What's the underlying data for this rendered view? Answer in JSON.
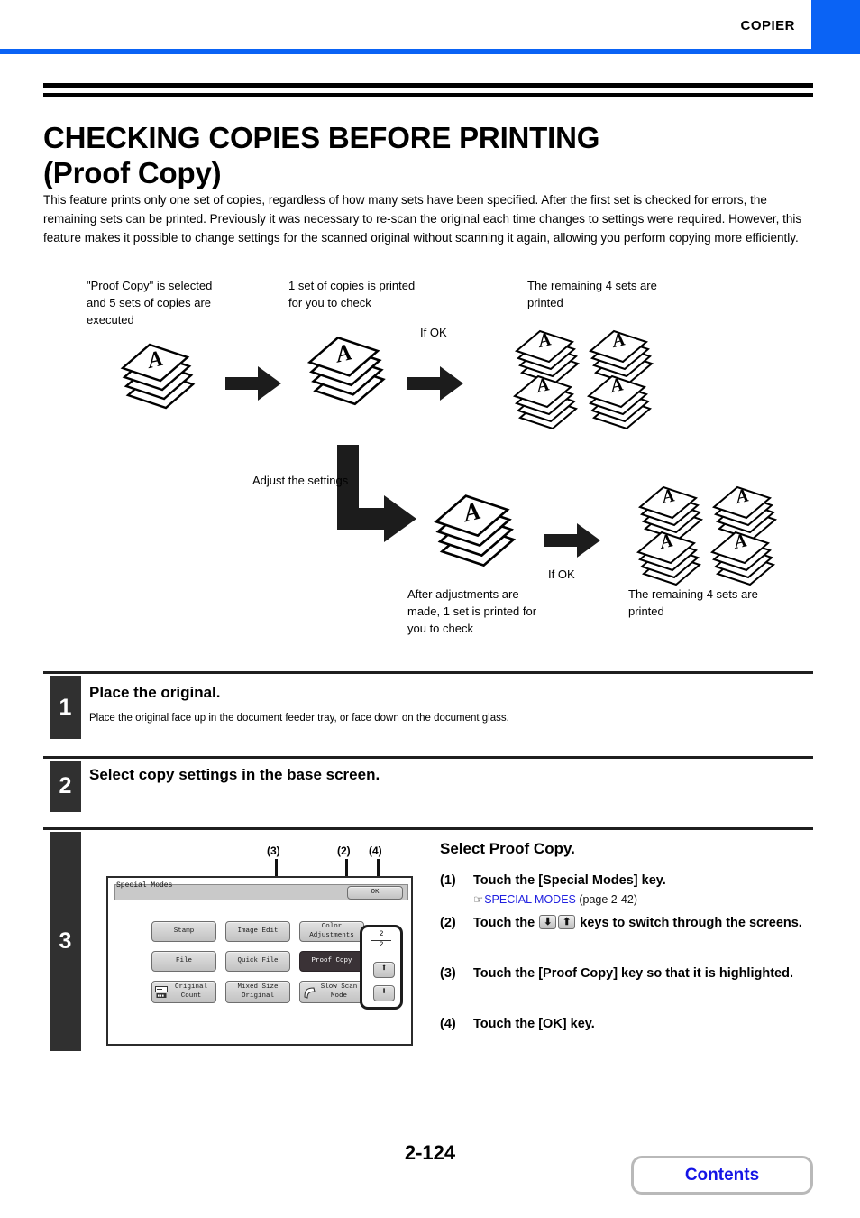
{
  "colors": {
    "brand": "#0a63f5",
    "link": "#2020e0",
    "tab": "#303030",
    "selected_key": "#3a3236"
  },
  "header": {
    "section_label": "COPIER"
  },
  "title": {
    "line1": "CHECKING COPIES BEFORE PRINTING",
    "line2": "(Proof Copy)"
  },
  "intro": "This feature prints only one set of copies, regardless of how many sets have been specified. After the first set is checked for errors, the remaining sets can be printed. Previously it was necessary to re-scan the original each time changes to settings were required. However, this feature makes it possible to change settings for the scanned original without scanning it again, allowing you perform copying more efficiently.",
  "figure": {
    "caption_a": "\"Proof Copy\" is selected and 5 sets of copies are executed",
    "caption_b": "1 set of copies is printed for you to check",
    "caption_c": "The remaining 4 sets are printed",
    "if_ok_top": "If OK",
    "adjust": "Adjust the settings",
    "caption_d": "After adjustments are made, 1 set is printed for you to check",
    "if_ok_bottom": "If OK",
    "caption_e": "The remaining 4 sets are printed",
    "sheet_glyph": "A"
  },
  "steps": [
    {
      "number": "1",
      "heading": "Place the original.",
      "body": "Place the original face up in the document feeder tray, or face down on the document glass."
    },
    {
      "number": "2",
      "heading": "Select copy settings in the base screen.",
      "body": ""
    },
    {
      "number": "3",
      "heading": "Select Proof Copy.",
      "items": [
        {
          "num": "(1)",
          "text": "Touch the [Special Modes] key."
        },
        {
          "num": "(2)",
          "text": "keys to switch through the screens.",
          "prefix": "Touch the"
        },
        {
          "num": "(3)",
          "text": "Touch the [Proof Copy] key so that it is highlighted."
        },
        {
          "num": "(4)",
          "text": "Touch the [OK] key."
        }
      ],
      "reference": {
        "hand_icon": "pointing-hand-icon",
        "link": "SPECIAL MODES",
        "page": "(page 2-42)"
      }
    }
  ],
  "lcd": {
    "title": "Special Modes",
    "ok_label": "OK",
    "keys": [
      {
        "id": "stamp",
        "label": "Stamp",
        "selected": false,
        "icon": null
      },
      {
        "id": "image-edit",
        "label": "Image Edit",
        "selected": false,
        "icon": null
      },
      {
        "id": "color-adjustments",
        "label": "Color\nAdjustments",
        "selected": false,
        "icon": null
      },
      {
        "id": "file",
        "label": "File",
        "selected": false,
        "icon": null
      },
      {
        "id": "quick-file",
        "label": "Quick File",
        "selected": false,
        "icon": null
      },
      {
        "id": "proof-copy",
        "label": "Proof Copy",
        "selected": true,
        "icon": null
      },
      {
        "id": "original-count",
        "label": "Original\nCount",
        "selected": false,
        "icon": "counter-icon"
      },
      {
        "id": "mixed-size-original",
        "label": "Mixed Size\nOriginal",
        "selected": false,
        "icon": null
      },
      {
        "id": "slow-scan-mode",
        "label": "Slow Scan\nMode",
        "selected": false,
        "icon": "slow-scan-icon"
      }
    ],
    "pager": {
      "current": "2",
      "total": "2",
      "up_icon": "arrow-up-icon",
      "down_icon": "arrow-down-icon"
    },
    "callouts": [
      "(3)",
      "(2)",
      "(4)"
    ]
  },
  "footer": {
    "page_number": "2-124",
    "contents_label": "Contents"
  }
}
